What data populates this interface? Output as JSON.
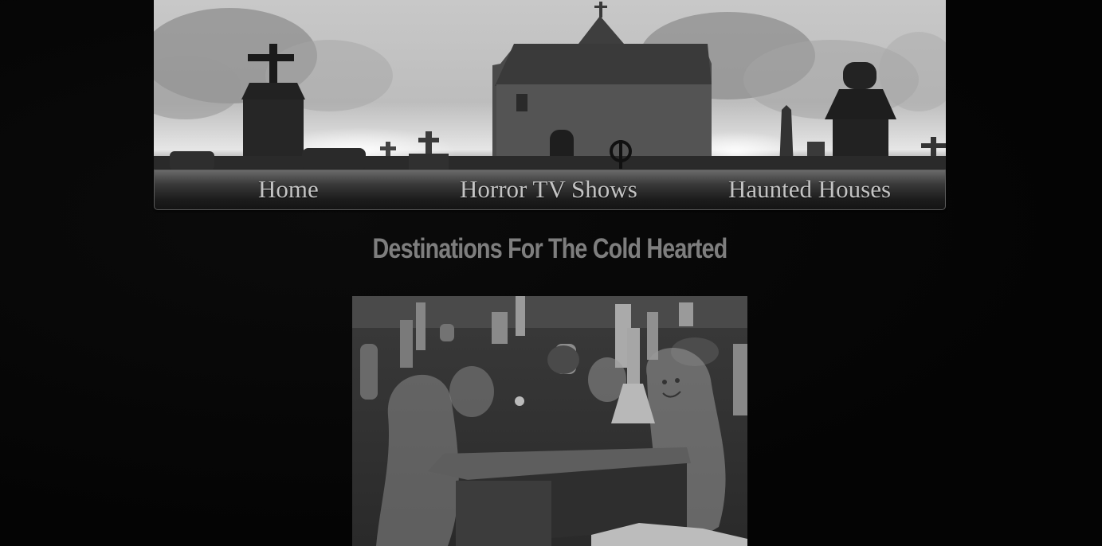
{
  "nav": {
    "items": [
      {
        "label": "Home"
      },
      {
        "label": "Horror TV Shows"
      },
      {
        "label": "Haunted Houses"
      }
    ]
  },
  "main": {
    "heading": "Destinations For The Cold Hearted"
  },
  "colors": {
    "background": "#050505",
    "nav_text": "#c4c4c4",
    "heading_text": "#7e7e7e"
  }
}
